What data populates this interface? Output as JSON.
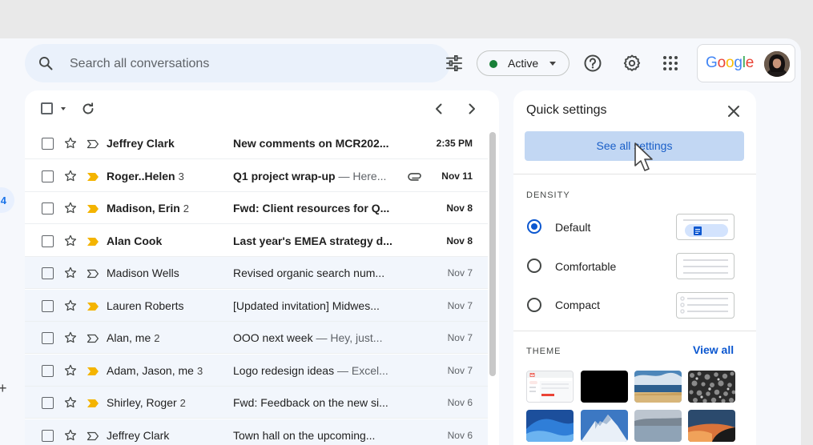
{
  "search": {
    "placeholder": "Search all conversations"
  },
  "status": {
    "label": "Active",
    "color": "#188038"
  },
  "left_rail": {
    "badge": "4"
  },
  "brand": {
    "logo_text": "Google"
  },
  "mail_list": {
    "rows": [
      {
        "sender": "Jeffrey Clark",
        "count": "",
        "subject": "New comments on MCR202...",
        "snippet": "",
        "date": "2:35 PM",
        "unread": true,
        "important": false,
        "attachment": false
      },
      {
        "sender": "Roger..Helen",
        "count": "3",
        "subject": "Q1 project wrap-up",
        "snippet": " — Here...",
        "date": "Nov 11",
        "unread": true,
        "important": true,
        "attachment": true
      },
      {
        "sender": "Madison, Erin",
        "count": "2",
        "subject": "Fwd: Client resources for Q...",
        "snippet": "",
        "date": "Nov 8",
        "unread": true,
        "important": true,
        "attachment": false
      },
      {
        "sender": "Alan Cook",
        "count": "",
        "subject": "Last year's EMEA strategy d...",
        "snippet": "",
        "date": "Nov 8",
        "unread": true,
        "important": true,
        "attachment": false
      },
      {
        "sender": "Madison Wells",
        "count": "",
        "subject": "Revised organic search num...",
        "snippet": "",
        "date": "Nov 7",
        "unread": false,
        "important": false,
        "attachment": false
      },
      {
        "sender": "Lauren Roberts",
        "count": "",
        "subject": "[Updated invitation] Midwes...",
        "snippet": "",
        "date": "Nov 7",
        "unread": false,
        "important": true,
        "attachment": false
      },
      {
        "sender": "Alan, me",
        "count": "2",
        "subject": "OOO next week",
        "snippet": " — Hey, just...",
        "date": "Nov 7",
        "unread": false,
        "important": false,
        "attachment": false
      },
      {
        "sender": "Adam, Jason, me",
        "count": "3",
        "subject": "Logo redesign ideas",
        "snippet": " — Excel...",
        "date": "Nov 7",
        "unread": false,
        "important": true,
        "attachment": false
      },
      {
        "sender": "Shirley, Roger",
        "count": "2",
        "subject": "Fwd: Feedback on the new si...",
        "snippet": "",
        "date": "Nov 6",
        "unread": false,
        "important": true,
        "attachment": false
      },
      {
        "sender": "Jeffrey Clark",
        "count": "",
        "subject": "Town hall on the upcoming...",
        "snippet": "",
        "date": "Nov 6",
        "unread": false,
        "important": false,
        "attachment": false
      }
    ]
  },
  "quick_settings": {
    "title": "Quick settings",
    "see_all": "See all settings",
    "density_label": "DENSITY",
    "density_options": [
      "Default",
      "Comfortable",
      "Compact"
    ],
    "density_selected": "Default",
    "theme_label": "THEME",
    "view_all": "View all"
  },
  "colors": {
    "accent": "#0b57d0",
    "important_marker": "#f4b400",
    "see_all_bg": "#c2d7f3"
  }
}
